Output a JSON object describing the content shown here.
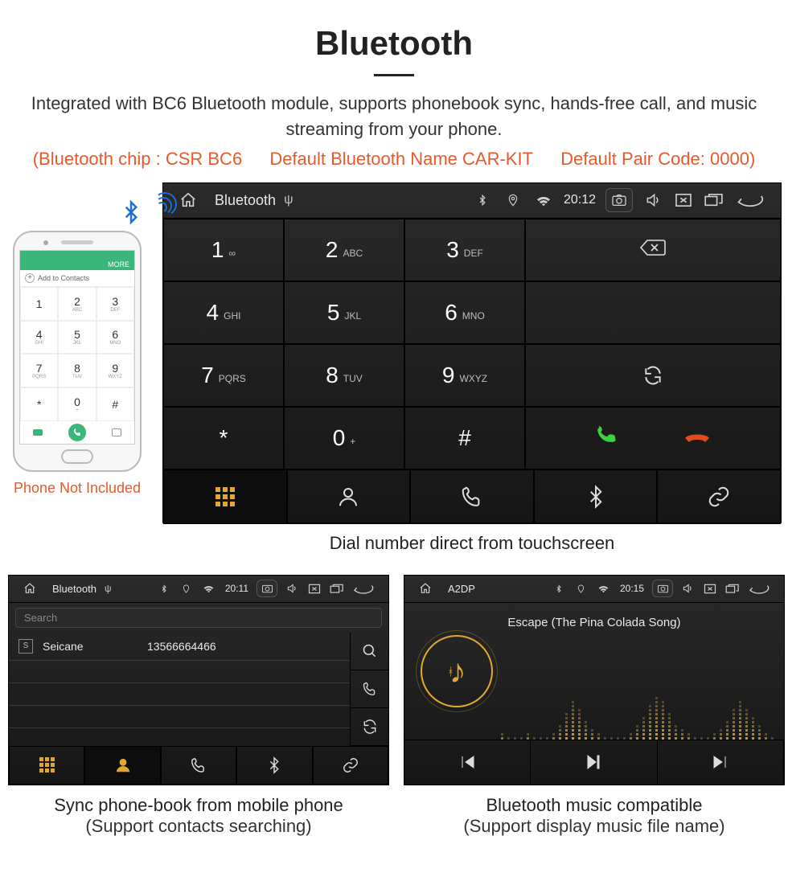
{
  "header": {
    "title": "Bluetooth",
    "subtitle": "Integrated with BC6 Bluetooth module, supports phonebook sync, hands-free call, and music streaming from your phone.",
    "spec_chip": "(Bluetooth chip : CSR BC6",
    "spec_name": "Default Bluetooth Name CAR-KIT",
    "spec_code": "Default Pair Code: 0000)"
  },
  "phone": {
    "more": "MORE",
    "add_to_contacts": "Add to Contacts",
    "keys": [
      {
        "n": "1",
        "l": ""
      },
      {
        "n": "2",
        "l": "ABC"
      },
      {
        "n": "3",
        "l": "DEF"
      },
      {
        "n": "4",
        "l": "GHI"
      },
      {
        "n": "5",
        "l": "JKL"
      },
      {
        "n": "6",
        "l": "MNO"
      },
      {
        "n": "7",
        "l": "PQRS"
      },
      {
        "n": "8",
        "l": "TUV"
      },
      {
        "n": "9",
        "l": "WXYZ"
      },
      {
        "n": "*",
        "l": ""
      },
      {
        "n": "0",
        "l": "+"
      },
      {
        "n": "#",
        "l": ""
      }
    ],
    "caption": "Phone Not Included"
  },
  "dialer": {
    "status": {
      "app_title": "Bluetooth",
      "usb": "⇅",
      "time": "20:12"
    },
    "keys": [
      {
        "n": "1",
        "l": "∞"
      },
      {
        "n": "2",
        "l": "ABC"
      },
      {
        "n": "3",
        "l": "DEF"
      },
      {
        "n": "4",
        "l": "GHI"
      },
      {
        "n": "5",
        "l": "JKL"
      },
      {
        "n": "6",
        "l": "MNO"
      },
      {
        "n": "7",
        "l": "PQRS"
      },
      {
        "n": "8",
        "l": "TUV"
      },
      {
        "n": "9",
        "l": "WXYZ"
      },
      {
        "n": "*",
        "l": ""
      },
      {
        "n": "0",
        "l": "+"
      },
      {
        "n": "#",
        "l": ""
      }
    ],
    "caption": "Dial number direct from touchscreen"
  },
  "phonebook": {
    "status": {
      "app_title": "Bluetooth",
      "time": "20:11"
    },
    "search_placeholder": "Search",
    "contacts": [
      {
        "letter": "S",
        "name": "Seicane",
        "number": "13566664466"
      }
    ],
    "caption_line1": "Sync phone-book from mobile phone",
    "caption_line2": "(Support contacts searching)"
  },
  "a2dp": {
    "status": {
      "app_title": "A2DP",
      "time": "20:15"
    },
    "track": "Escape (The Pina Colada Song)",
    "caption_line1": "Bluetooth music compatible",
    "caption_line2": "(Support display music file name)"
  }
}
